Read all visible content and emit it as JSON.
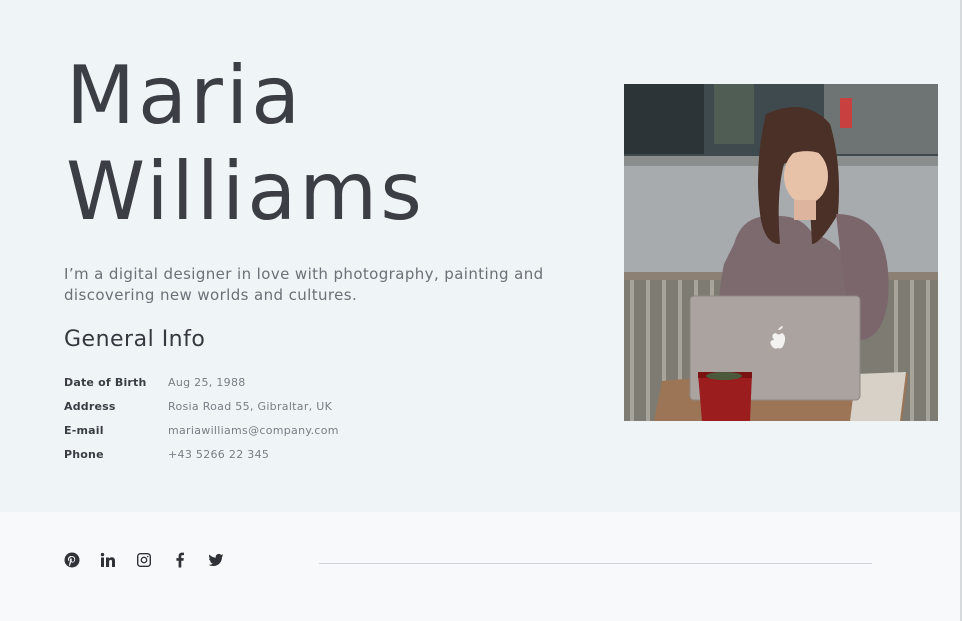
{
  "profile": {
    "first_name": "Maria",
    "last_name": "Williams",
    "intro": "I’m a digital designer in love with photography, painting and discovering new worlds and cultures."
  },
  "general_info": {
    "title": "General Info",
    "rows": [
      {
        "label": "Date of Birth",
        "value": "Aug 25, 1988"
      },
      {
        "label": "Address",
        "value": "Rosia Road 55, Gibraltar, UK"
      },
      {
        "label": "E-mail",
        "value": "mariawilliams@company.com"
      },
      {
        "label": "Phone",
        "value": "+43 5266 22 345"
      }
    ]
  },
  "social": [
    {
      "name": "pinterest-icon"
    },
    {
      "name": "linkedin-icon"
    },
    {
      "name": "instagram-icon"
    },
    {
      "name": "facebook-icon"
    },
    {
      "name": "twitter-icon"
    }
  ],
  "colors": {
    "hero_bg": "#eff4f7",
    "footer_bg": "#f8f9fa",
    "heading": "#3b3f45",
    "body_text": "#6c7077"
  }
}
